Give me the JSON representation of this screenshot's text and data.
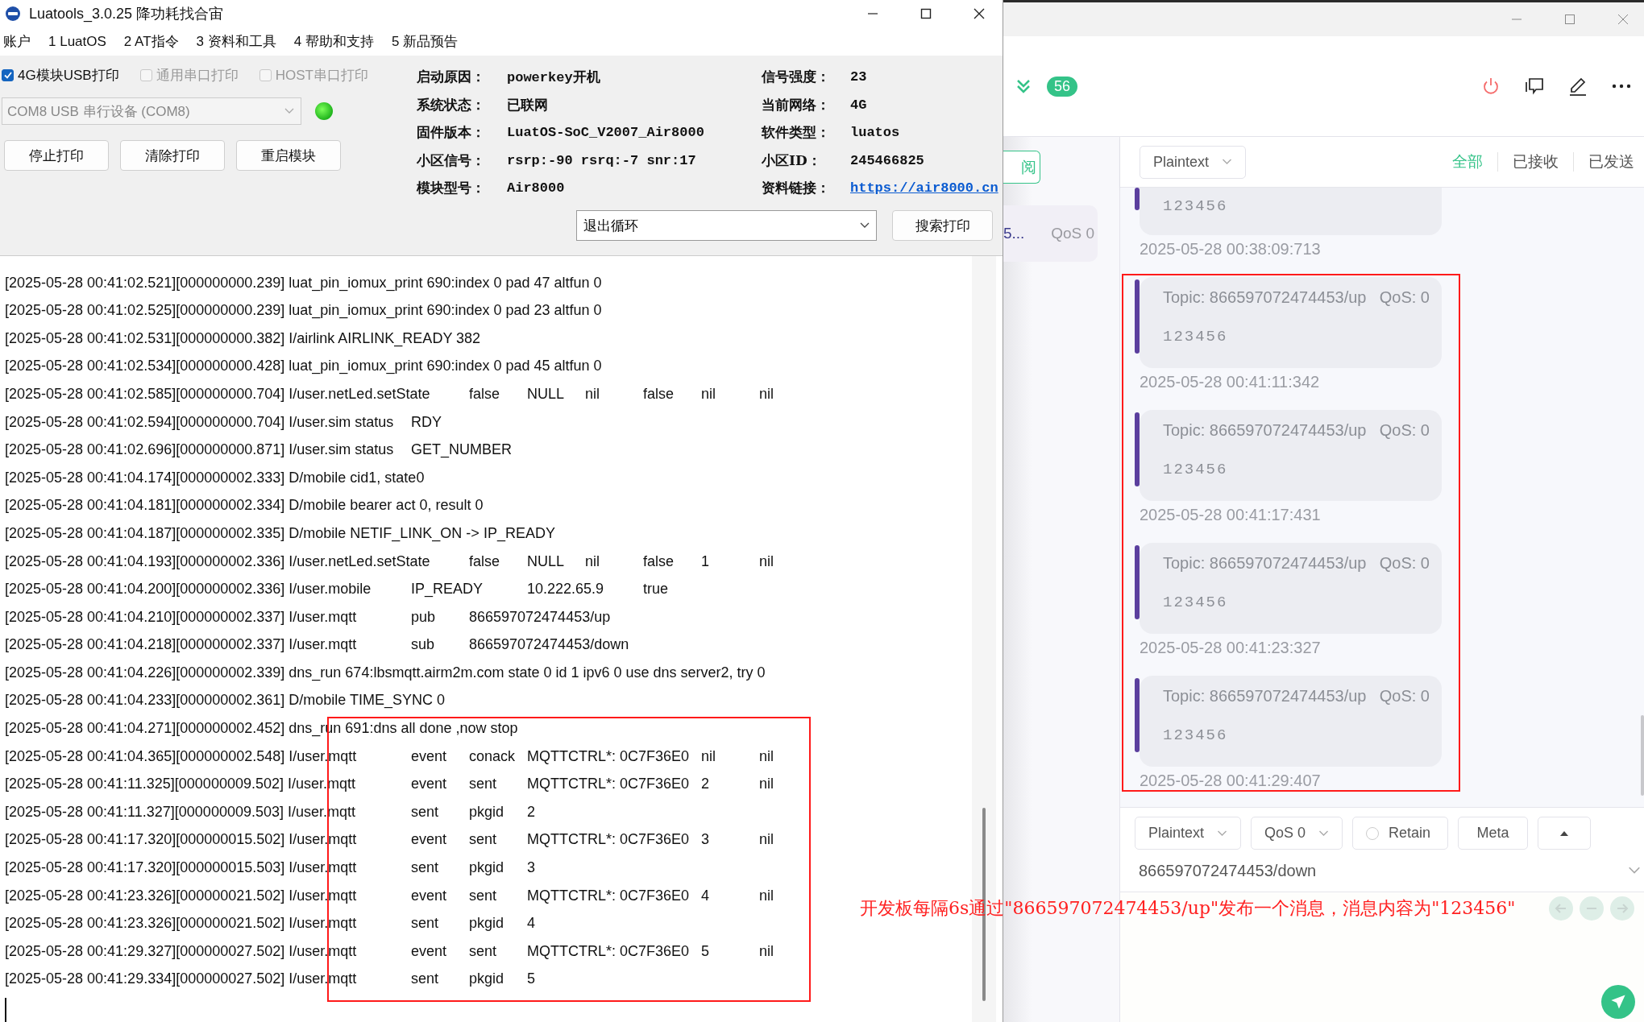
{
  "left_window": {
    "title": "Luatools_3.0.25 降功耗找合宙",
    "menu": [
      "账户",
      "1 LuatOS",
      "2 AT指令",
      "3 资料和工具",
      "4 帮助和支持",
      "5 新品预告"
    ],
    "print_options": [
      {
        "label": "4G模块USB打印",
        "checked": true,
        "disabled": false
      },
      {
        "label": "通用串口打印",
        "checked": false,
        "disabled": true
      },
      {
        "label": "HOST串口打印",
        "checked": false,
        "disabled": true
      }
    ],
    "port_select": {
      "value": "COM8 USB 串行设备 (COM8)",
      "disabled": true
    },
    "port_led": {
      "on": true
    },
    "buttons": [
      "停止打印",
      "清除打印",
      "重启模块"
    ],
    "info": [
      {
        "label": "启动原因：",
        "value": "powerkey开机",
        "kind": "text"
      },
      {
        "label": "信号强度：",
        "value": "23",
        "kind": "text"
      },
      {
        "label": "系统状态：",
        "value": "已联网",
        "kind": "text"
      },
      {
        "label": "当前网络：",
        "value": "4G",
        "kind": "text"
      },
      {
        "label": "固件版本：",
        "value": "LuatOS-SoC_V2007_Air8000",
        "kind": "text"
      },
      {
        "label": "软件类型：",
        "value": "luatos",
        "kind": "text"
      },
      {
        "label": "小区信号：",
        "value": "rsrp:-90 rsrq:-7 snr:17",
        "kind": "text"
      },
      {
        "label": "小区ID：",
        "value": "245466825",
        "kind": "text"
      },
      {
        "label": "模块型号：",
        "value": "Air8000",
        "kind": "text"
      },
      {
        "label": "资料链接：",
        "value": "https://air8000.cn",
        "kind": "link"
      }
    ],
    "loop_select": {
      "value": "退出循环"
    },
    "search_button": "搜索打印",
    "log_lines": [
      "[2025-05-28 00:41:02.521][000000000.239] luat_pin_iomux_print 690:index 0 pad 47 altfun 0",
      "[2025-05-28 00:41:02.525][000000000.239] luat_pin_iomux_print 690:index 0 pad 23 altfun 0",
      "[2025-05-28 00:41:02.531][000000000.382] I/airlink AIRLINK_READY 382",
      "[2025-05-28 00:41:02.534][000000000.428] luat_pin_iomux_print 690:index 0 pad 45 altfun 0",
      "[2025-05-28 00:41:02.585][000000000.704] I/user.netLed.setState\tfalse\tNULL\tnil\tfalse\tnil\tnil",
      "[2025-05-28 00:41:02.594][000000000.704] I/user.sim status\tRDY",
      "[2025-05-28 00:41:02.696][000000000.871] I/user.sim status\tGET_NUMBER",
      "[2025-05-28 00:41:04.174][000000002.333] D/mobile cid1, state0",
      "[2025-05-28 00:41:04.181][000000002.334] D/mobile bearer act 0, result 0",
      "[2025-05-28 00:41:04.187][000000002.335] D/mobile NETIF_LINK_ON -> IP_READY",
      "[2025-05-28 00:41:04.193][000000002.336] I/user.netLed.setState\tfalse\tNULL\tnil\tfalse\t1\tnil",
      "[2025-05-28 00:41:04.200][000000002.336] I/user.mobile\tIP_READY\t10.222.65.9\ttrue",
      "[2025-05-28 00:41:04.210][000000002.337] I/user.mqtt\tpub\t866597072474453/up",
      "[2025-05-28 00:41:04.218][000000002.337] I/user.mqtt\tsub\t866597072474453/down",
      "[2025-05-28 00:41:04.226][000000002.339] dns_run 674:lbsmqtt.airm2m.com state 0 id 1 ipv6 0 use dns server2, try 0",
      "[2025-05-28 00:41:04.233][000000002.361] D/mobile TIME_SYNC 0",
      "[2025-05-28 00:41:04.271][000000002.452] dns_run 691:dns all done ,now stop",
      "[2025-05-28 00:41:04.365][000000002.548] I/user.mqtt\tevent\tconack\tMQTTCTRL*: 0C7F36E0\tnil\tnil",
      "[2025-05-28 00:41:11.325][000000009.502] I/user.mqtt\tevent\tsent\tMQTTCTRL*: 0C7F36E0\t2\tnil",
      "[2025-05-28 00:41:11.327][000000009.503] I/user.mqtt\tsent\tpkgid\t2",
      "[2025-05-28 00:41:17.320][000000015.502] I/user.mqtt\tevent\tsent\tMQTTCTRL*: 0C7F36E0\t3\tnil",
      "[2025-05-28 00:41:17.320][000000015.503] I/user.mqtt\tsent\tpkgid\t3",
      "[2025-05-28 00:41:23.326][000000021.502] I/user.mqtt\tevent\tsent\tMQTTCTRL*: 0C7F36E0\t4\tnil",
      "[2025-05-28 00:41:23.326][000000021.502] I/user.mqtt\tsent\tpkgid\t4",
      "[2025-05-28 00:41:29.327][000000027.502] I/user.mqtt\tevent\tsent\tMQTTCTRL*: 0C7F36E0\t5\tnil",
      "[2025-05-28 00:41:29.334][000000027.502] I/user.mqtt\tsent\tpkgid\t5"
    ]
  },
  "right_window": {
    "message_count": "56",
    "subscription_button": "阅",
    "subscription_card": {
      "topic": "5...",
      "qos": "QoS 0"
    },
    "format_select": "Plaintext",
    "filter_tabs": [
      {
        "label": "全部",
        "selected": true
      },
      {
        "label": "已接收",
        "selected": false
      },
      {
        "label": "已发送",
        "selected": false
      }
    ],
    "messages": [
      {
        "payload": "123456",
        "time": "2025-05-28 00:38:09:713"
      },
      {
        "topic": "Topic: 866597072474453/up",
        "qos": "QoS: 0",
        "payload": "123456",
        "time": "2025-05-28 00:41:11:342"
      },
      {
        "topic": "Topic: 866597072474453/up",
        "qos": "QoS: 0",
        "payload": "123456",
        "time": "2025-05-28 00:41:17:431"
      },
      {
        "topic": "Topic: 866597072474453/up",
        "qos": "QoS: 0",
        "payload": "123456",
        "time": "2025-05-28 00:41:23:327"
      },
      {
        "topic": "Topic: 866597072474453/up",
        "qos": "QoS: 0",
        "payload": "123456",
        "time": "2025-05-28 00:41:29:407"
      }
    ],
    "composer": {
      "format": "Plaintext",
      "qos": "QoS 0",
      "retain": {
        "label": "Retain",
        "checked": false
      },
      "meta": "Meta",
      "topic": "866597072474453/down"
    }
  },
  "annotation": {
    "text": "开发板每隔6s通过\"866597072474453/up\"发布一个消息，消息内容为\"123456\""
  }
}
